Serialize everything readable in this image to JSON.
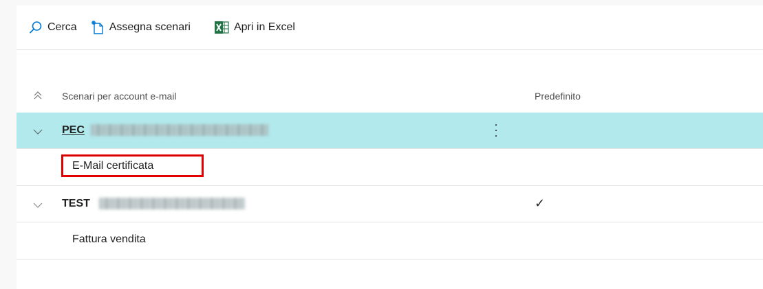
{
  "toolbar": {
    "search_label": "Cerca",
    "assign_label": "Assegna scenari",
    "excel_label": "Apri in Excel"
  },
  "list": {
    "column_scenarios": "Scenari per account e-mail",
    "column_default": "Predefinito",
    "groups": [
      {
        "name": "PEC",
        "selected": true,
        "default": false,
        "children": [
          "E-Mail certificata"
        ]
      },
      {
        "name": "TEST",
        "selected": false,
        "default": true,
        "children": [
          "Fattura vendita"
        ]
      }
    ]
  },
  "colors": {
    "accent": "#0078d4",
    "selected_row": "#b2e9ec",
    "highlight": "#e00000",
    "excel_green": "#217346"
  },
  "icons": [
    "search-icon",
    "assign-icon",
    "excel-icon",
    "collapse-all-icon",
    "chevron-down-icon",
    "more-options-icon",
    "check-icon"
  ]
}
